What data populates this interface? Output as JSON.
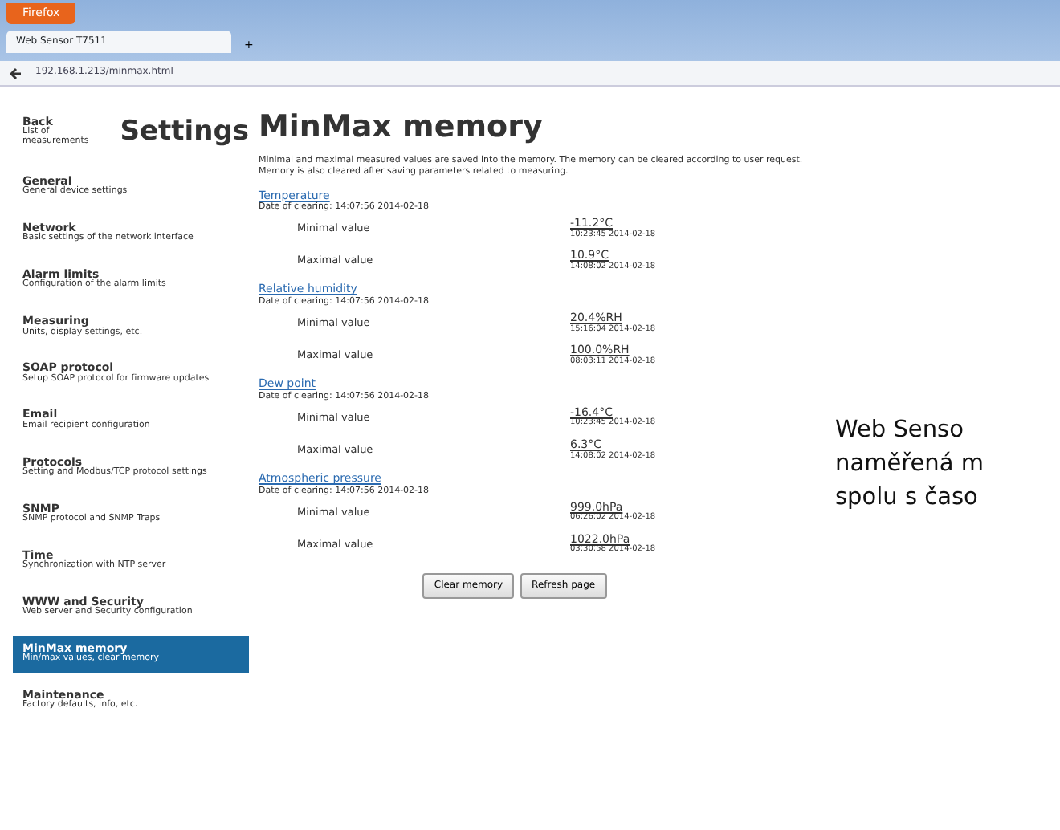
{
  "browser": {
    "menu_button": "Firefox",
    "tab_title": "Web Sensor T7511",
    "new_tab": "+",
    "url": "192.168.1.213/minmax.html"
  },
  "sidebar": {
    "title": "Settings",
    "back": {
      "label": "Back",
      "sub": "List of measurements"
    },
    "items": [
      {
        "label": "General",
        "sub": "General device settings",
        "selected": false
      },
      {
        "label": "Network",
        "sub": "Basic settings of the network interface",
        "selected": false
      },
      {
        "label": "Alarm limits",
        "sub": "Configuration of the alarm limits",
        "selected": false
      },
      {
        "label": "Measuring",
        "sub": "Units, display settings, etc.",
        "selected": false
      },
      {
        "label": "SOAP protocol",
        "sub": "Setup SOAP protocol for firmware updates",
        "selected": false
      },
      {
        "label": "Email",
        "sub": "Email recipient configuration",
        "selected": false
      },
      {
        "label": "Protocols",
        "sub": "Setting and Modbus/TCP protocol settings",
        "selected": false
      },
      {
        "label": "SNMP",
        "sub": "SNMP protocol and SNMP Traps",
        "selected": false
      },
      {
        "label": "Time",
        "sub": "Synchronization with NTP server",
        "selected": false
      },
      {
        "label": "WWW and Security",
        "sub": "Web server and Security configuration",
        "selected": false
      },
      {
        "label": "MinMax memory",
        "sub": "Min/max values, clear memory",
        "selected": true
      },
      {
        "label": "Maintenance",
        "sub": "Factory defaults, info, etc.",
        "selected": false
      }
    ]
  },
  "main": {
    "title": "MinMax memory",
    "description": "Minimal and maximal measured values are saved into the memory. The memory can be cleared according to user request. Memory is also cleared after saving parameters related to measuring.",
    "sections": [
      {
        "name": "Temperature",
        "cleared": "Date of clearing: 14:07:56 2014-02-18",
        "rows": [
          {
            "label": "Minimal value",
            "value": "-11.2°C",
            "time": "10:23:45 2014-02-18"
          },
          {
            "label": "Maximal value",
            "value": "10.9°C",
            "time": "14:08:02 2014-02-18"
          }
        ]
      },
      {
        "name": "Relative humidity",
        "cleared": "Date of clearing: 14:07:56 2014-02-18",
        "rows": [
          {
            "label": "Minimal value",
            "value": "20.4%RH",
            "time": "15:16:04 2014-02-18"
          },
          {
            "label": "Maximal value",
            "value": "100.0%RH",
            "time": "08:03:11 2014-02-18"
          }
        ]
      },
      {
        "name": "Dew point",
        "cleared": "Date of clearing: 14:07:56 2014-02-18",
        "rows": [
          {
            "label": "Minimal value",
            "value": "-16.4°C",
            "time": "10:23:45 2014-02-18"
          },
          {
            "label": "Maximal value",
            "value": "6.3°C",
            "time": "14:08:02 2014-02-18"
          }
        ]
      },
      {
        "name": "Atmospheric pressure",
        "cleared": "Date of clearing: 14:07:56 2014-02-18",
        "rows": [
          {
            "label": "Minimal value",
            "value": "999.0hPa",
            "time": "06:26:02 2014-02-18"
          },
          {
            "label": "Maximal value",
            "value": "1022.0hPa",
            "time": "03:30:58 2014-02-18"
          }
        ]
      }
    ],
    "buttons": [
      "Clear memory",
      "Refresh page"
    ]
  },
  "article_lines": [
    "Web Senso",
    "naměřená m",
    "spolu s časo"
  ]
}
